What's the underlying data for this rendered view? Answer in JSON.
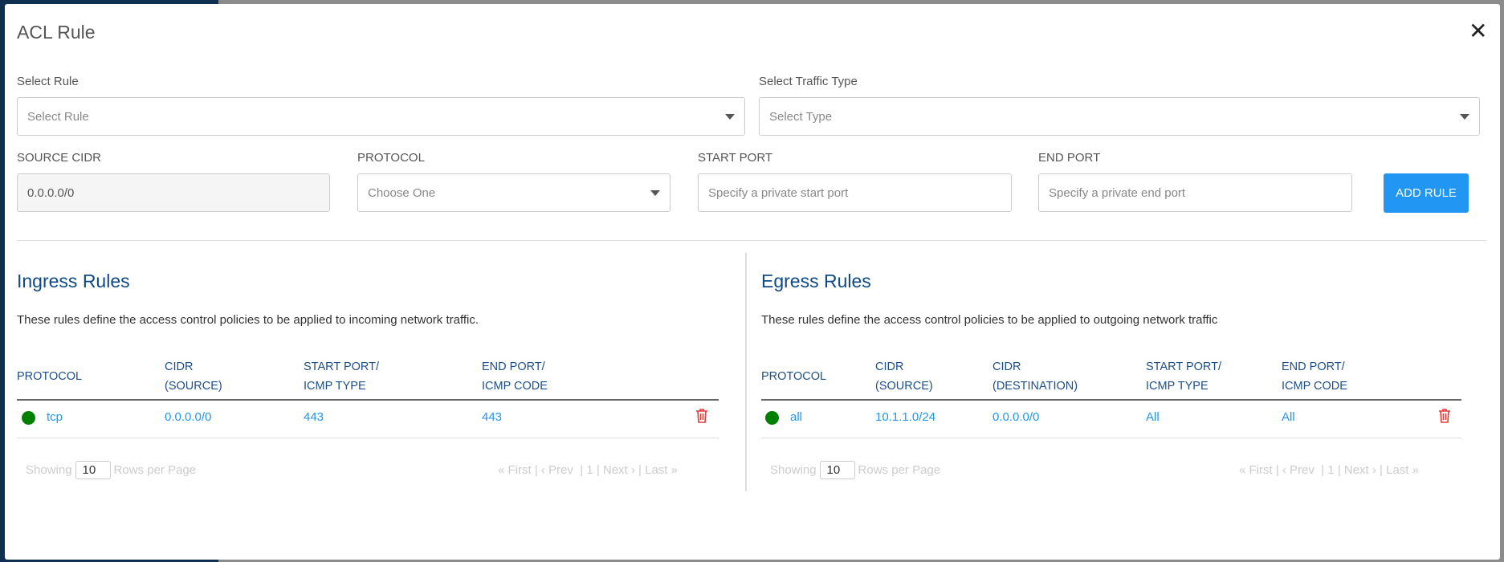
{
  "dialog": {
    "title": "ACL Rule",
    "close_icon": "close-icon"
  },
  "form": {
    "select_rule": {
      "label": "Select Rule",
      "placeholder": "Select Rule"
    },
    "traffic_type": {
      "label": "Select Traffic Type",
      "placeholder": "Select Type"
    },
    "source_cidr": {
      "label": "SOURCE CIDR",
      "value": "0.0.0.0/0"
    },
    "protocol": {
      "label": "PROTOCOL",
      "placeholder": "Choose One"
    },
    "start_port": {
      "label": "START PORT",
      "placeholder": "Specify a private start port"
    },
    "end_port": {
      "label": "END PORT",
      "placeholder": "Specify a private end port"
    },
    "add_rule": "ADD RULE"
  },
  "ingress": {
    "title": "Ingress Rules",
    "description": "These rules define the access control policies to be applied to incoming network traffic.",
    "headers": [
      [
        "PROTOCOL",
        ""
      ],
      [
        "CIDR",
        "(SOURCE)"
      ],
      [
        "START PORT/",
        "ICMP TYPE"
      ],
      [
        "END PORT/",
        "ICMP CODE"
      ]
    ],
    "rows": [
      {
        "protocol": "tcp",
        "cidr_source": "0.0.0.0/0",
        "start": "443",
        "end": "443",
        "status_color": "#008000"
      }
    ],
    "pagination": {
      "showing": "Showing",
      "rows_per_page": "10",
      "rows_label": "Rows per Page",
      "nav": "« First | ‹ Prev  | 1 | Next › | Last »"
    }
  },
  "egress": {
    "title": "Egress Rules",
    "description": "These rules define the access control policies to be applied to outgoing network traffic",
    "headers": [
      [
        "PROTOCOL",
        ""
      ],
      [
        "CIDR",
        "(SOURCE)"
      ],
      [
        "CIDR",
        "(DESTINATION)"
      ],
      [
        "START PORT/",
        "ICMP TYPE"
      ],
      [
        "END PORT/",
        "ICMP CODE"
      ]
    ],
    "rows": [
      {
        "protocol": "all",
        "cidr_source": "10.1.1.0/24",
        "cidr_dest": "0.0.0.0/0",
        "start": "All",
        "end": "All",
        "status_color": "#008000"
      }
    ],
    "pagination": {
      "showing": "Showing",
      "rows_per_page": "10",
      "rows_label": "Rows per Page",
      "nav": "« First | ‹ Prev  | 1 | Next › | Last »"
    }
  },
  "colors": {
    "accent": "#2196f3",
    "heading": "#0f4a86",
    "delete": "#e53935"
  }
}
